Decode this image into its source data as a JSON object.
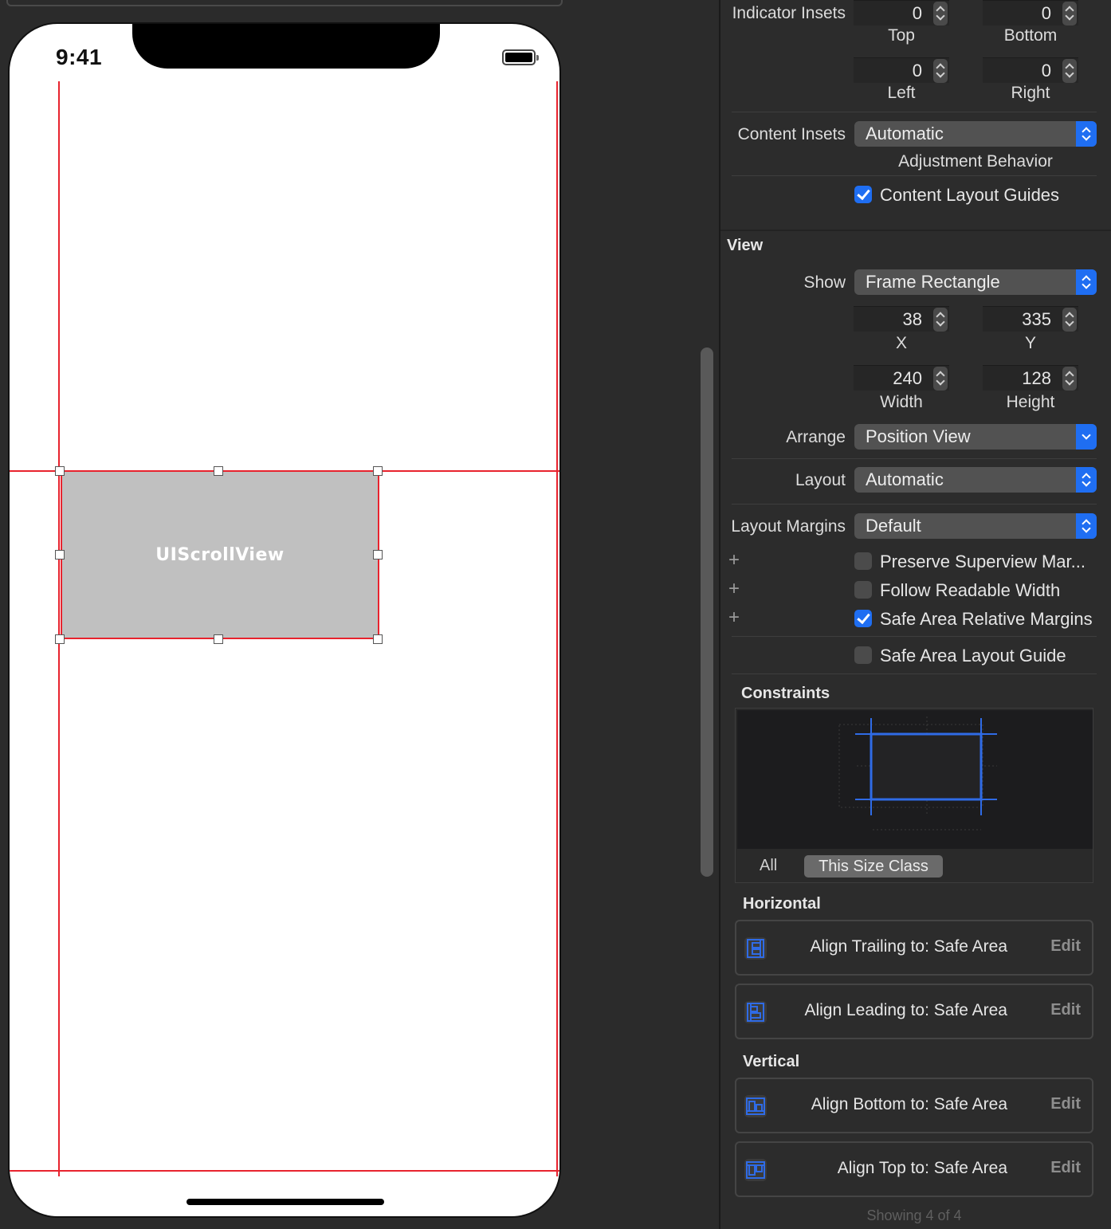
{
  "canvas": {
    "status_time": "9:41",
    "scroll_view_label": "UIScrollView"
  },
  "inspector": {
    "indicator_insets": {
      "label": "Indicator Insets",
      "top": {
        "value": "0",
        "label": "Top"
      },
      "bottom": {
        "value": "0",
        "label": "Bottom"
      },
      "left": {
        "value": "0",
        "label": "Left"
      },
      "right": {
        "value": "0",
        "label": "Right"
      }
    },
    "content_insets": {
      "label": "Content Insets",
      "value": "Automatic",
      "sub_label": "Adjustment Behavior"
    },
    "content_layout_guides": {
      "label": "Content Layout Guides",
      "checked": true
    },
    "view_section": {
      "title": "View",
      "show_label": "Show",
      "show_value": "Frame Rectangle",
      "x": {
        "value": "38",
        "label": "X"
      },
      "y": {
        "value": "335",
        "label": "Y"
      },
      "width": {
        "value": "240",
        "label": "Width"
      },
      "height": {
        "value": "128",
        "label": "Height"
      },
      "arrange_label": "Arrange",
      "arrange_value": "Position View",
      "layout_label": "Layout",
      "layout_value": "Automatic",
      "layout_margins_label": "Layout Margins",
      "layout_margins_value": "Default",
      "preserve_superview": {
        "label": "Preserve Superview Mar...",
        "checked": false
      },
      "follow_readable": {
        "label": "Follow Readable Width",
        "checked": false
      },
      "safe_area_relative": {
        "label": "Safe Area Relative Margins",
        "checked": true
      },
      "safe_area_layout_guide": {
        "label": "Safe Area Layout Guide",
        "checked": false
      }
    },
    "constraints": {
      "title": "Constraints",
      "tab_all": "All",
      "tab_this_size_class": "This Size Class",
      "horizontal_title": "Horizontal",
      "vertical_title": "Vertical",
      "horizontal": [
        {
          "text": "Align Trailing to:  Safe Area",
          "edit": "Edit",
          "icon": "align-trailing-icon"
        },
        {
          "text": "Align Leading to:  Safe Area",
          "edit": "Edit",
          "icon": "align-leading-icon"
        }
      ],
      "vertical": [
        {
          "text": "Align Bottom to:  Safe Area",
          "edit": "Edit",
          "icon": "align-bottom-icon"
        },
        {
          "text": "Align Top to:  Safe Area",
          "edit": "Edit",
          "icon": "align-top-icon"
        }
      ],
      "footer": "Showing 4 of 4"
    },
    "colors": {
      "accent": "#1f6ef2",
      "guide_red": "#e8232e"
    }
  }
}
